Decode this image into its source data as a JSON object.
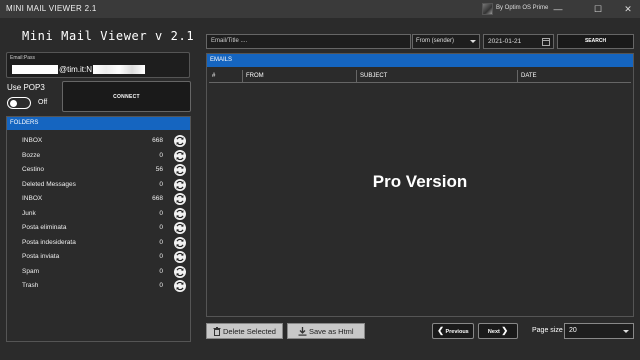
{
  "window": {
    "title": "MINI MAIL VIEWER 2.1",
    "by_label": "By Optim OS Prime",
    "minimize_glyph": "—",
    "maximize_glyph": "☐",
    "close_glyph": "✕"
  },
  "app": {
    "heading": "Mini Mail Viewer v 2.1"
  },
  "account": {
    "label": "Email:Pass",
    "value": "@tim.it:N"
  },
  "pop3": {
    "label": "Use POP3",
    "state": "Off",
    "enabled": false
  },
  "connect": {
    "label": "CONNECT"
  },
  "folders": {
    "header": "FOLDERS",
    "items": [
      {
        "name": "INBOX",
        "count": "668"
      },
      {
        "name": "Bozze",
        "count": "0"
      },
      {
        "name": "Cestino",
        "count": "56"
      },
      {
        "name": "Deleted Messages",
        "count": "0"
      },
      {
        "name": "INBOX",
        "count": "668"
      },
      {
        "name": "Junk",
        "count": "0"
      },
      {
        "name": "Posta eliminata",
        "count": "0"
      },
      {
        "name": "Posta indesiderata",
        "count": "0"
      },
      {
        "name": "Posta inviata",
        "count": "0"
      },
      {
        "name": "Spam",
        "count": "0"
      },
      {
        "name": "Trash",
        "count": "0"
      }
    ]
  },
  "search": {
    "placeholder": "Email/Title ....",
    "filter": "From (sender)",
    "date": "2021-01-21",
    "button": "SEARCH"
  },
  "emails": {
    "header": "EMAILS",
    "columns": [
      "#",
      "FROM",
      "SUBJECT",
      "DATE"
    ],
    "overlay": "Pro Version"
  },
  "footer": {
    "delete_label": "Delete Selected",
    "save_label": "Save as Html",
    "previous_label": "Previous",
    "next_label": "Next",
    "page_size_label": "Page size",
    "page_size_value": "20"
  },
  "colors": {
    "accent": "#1565c0",
    "background": "#2b2b2b",
    "titlebar": "#3a3a3a"
  }
}
